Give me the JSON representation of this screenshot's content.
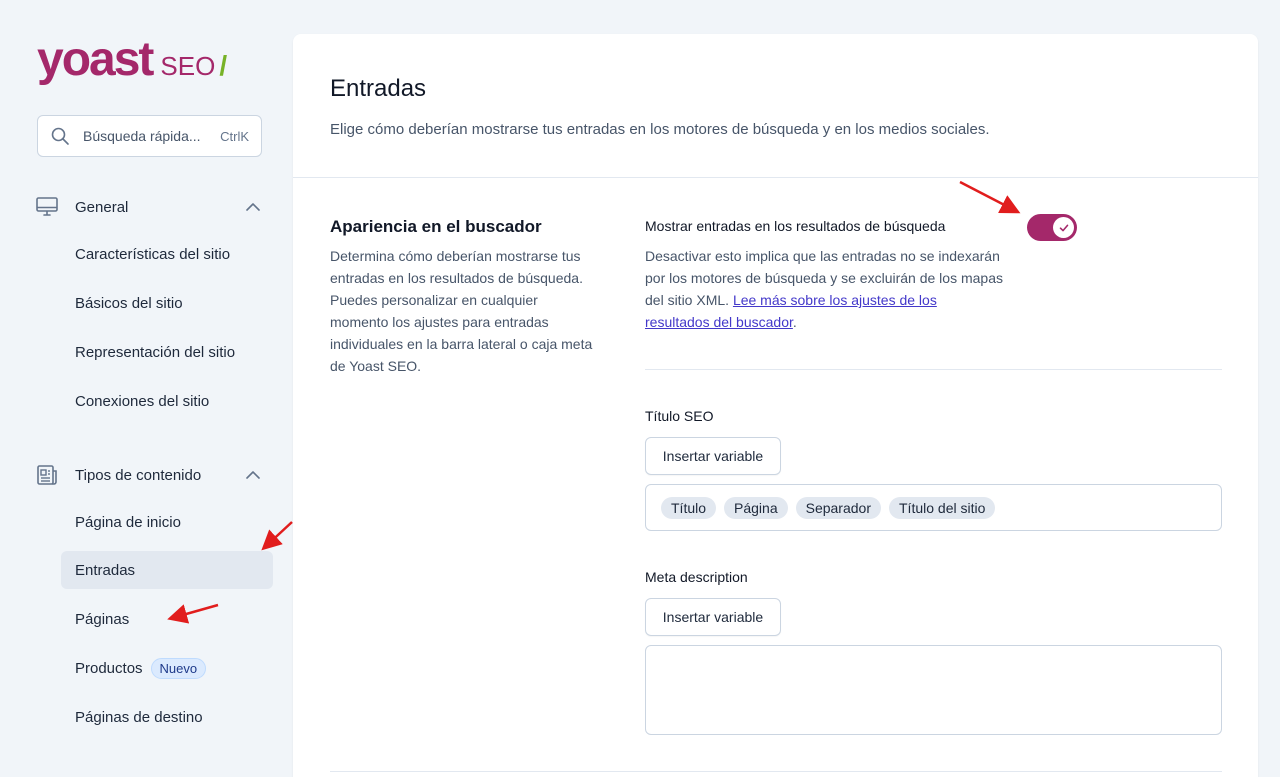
{
  "logo": {
    "word": "yoast",
    "seo": "SEO",
    "slash": "/"
  },
  "search": {
    "placeholder": "Búsqueda rápida...",
    "shortcut": "CtrlK"
  },
  "sidebar": {
    "groups": [
      {
        "label": "General",
        "icon": "monitor-icon",
        "items": [
          "Características del sitio",
          "Básicos del sitio",
          "Representación del sitio",
          "Conexiones del sitio"
        ]
      },
      {
        "label": "Tipos de contenido",
        "icon": "newspaper-icon",
        "items": [
          "Página de inicio",
          "Entradas",
          "Páginas",
          "Productos",
          "Páginas de destino"
        ]
      }
    ],
    "active_item": "Entradas",
    "badge": "Nuevo"
  },
  "main": {
    "title": "Entradas",
    "subtitle": "Elige cómo deberían mostrarse tus entradas en los motores de búsqueda y en los medios sociales.",
    "section": {
      "title": "Apariencia en el buscador",
      "description": "Determina cómo deberían mostrarse tus entradas en los resultados de búsqueda. Puedes personalizar en cualquier momento los ajustes para entradas individuales en la barra lateral o caja meta de Yoast SEO."
    },
    "option": {
      "label": "Mostrar entradas en los resultados de búsqueda",
      "description_prefix": "Desactivar esto implica que las entradas no se indexarán por los motores de búsqueda y se excluirán de los mapas del sitio XML. ",
      "link_text": "Lee más sobre los ajustes de los resultados del buscador",
      "description_suffix": ".",
      "enabled": true
    },
    "seo_title": {
      "label": "Título SEO",
      "button": "Insertar variable",
      "chips": [
        "Título",
        "Página",
        "Separador",
        "Título del sitio"
      ]
    },
    "meta_description": {
      "label": "Meta description",
      "button": "Insertar variable",
      "value": ""
    }
  },
  "colors": {
    "brand": "#a4286a",
    "accent_green": "#77b227",
    "link": "#4338ca",
    "arrow": "#e11d1d"
  }
}
